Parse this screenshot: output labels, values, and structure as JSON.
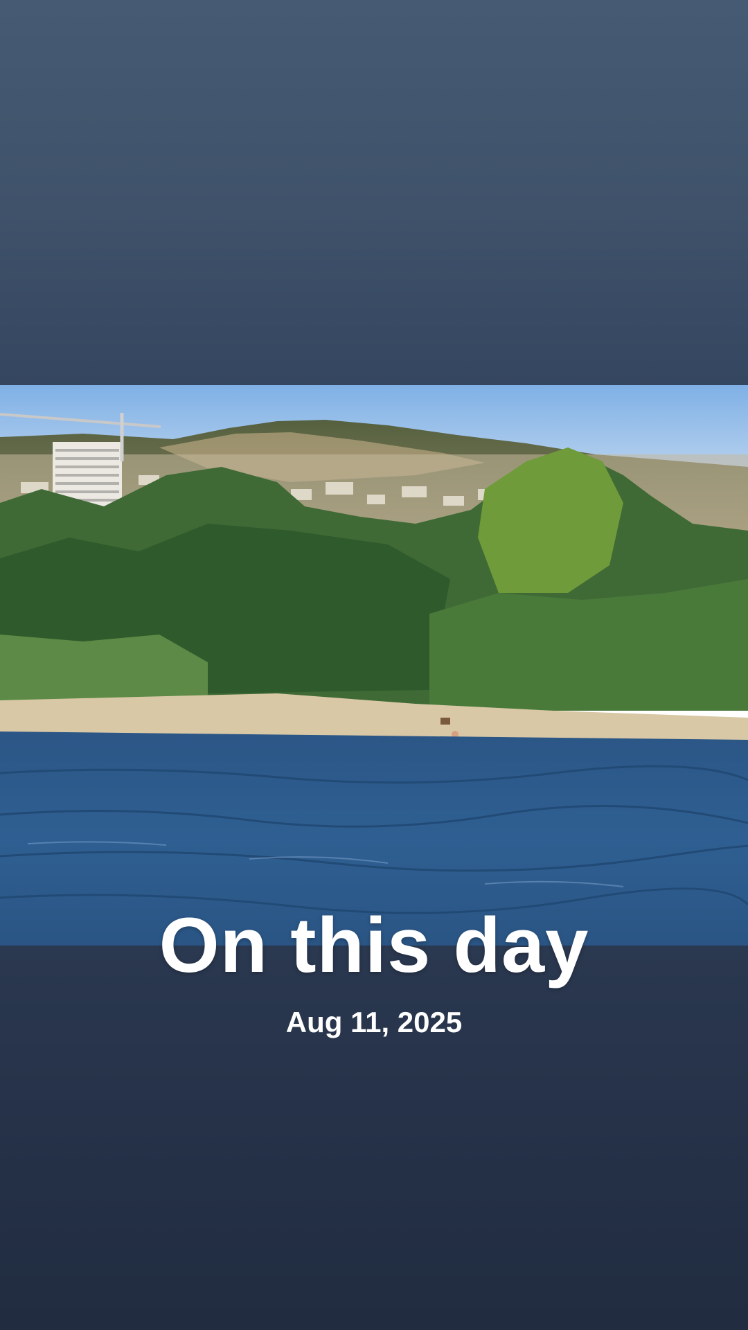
{
  "memory": {
    "title": "On this day",
    "date": "Aug 11, 2025"
  },
  "photo": {
    "description_icon": "photo-thumbnail"
  },
  "colors": {
    "top_band": "#3f526a",
    "bottom_band": "#243046",
    "text": "#ffffff",
    "sky": "#8fb8e6",
    "water": "#2f5f8f",
    "sand": "#d9c8a6"
  }
}
